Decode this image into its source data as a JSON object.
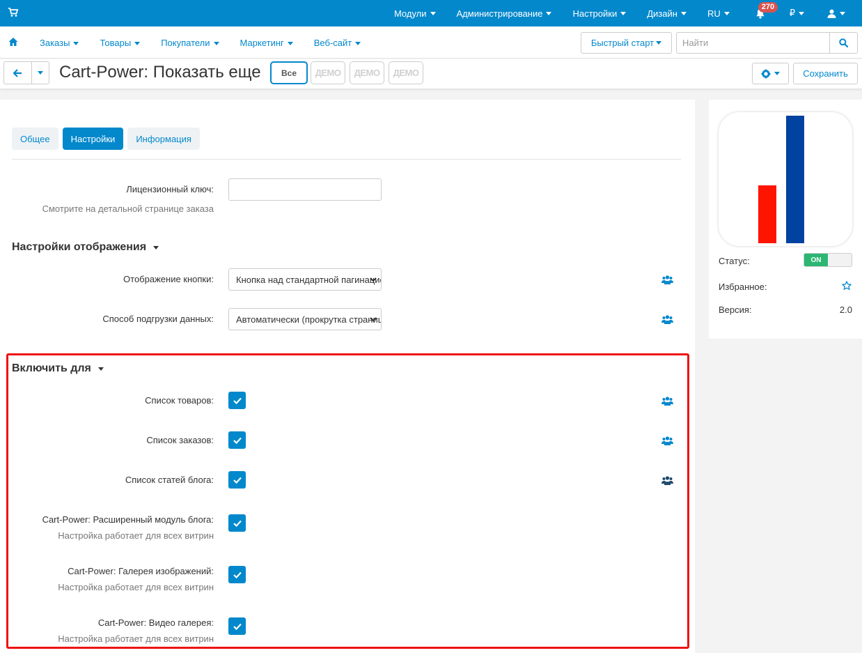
{
  "colors": {
    "primary": "#0388cc",
    "highlight_border": "#ee1111",
    "toggle_on": "#2bb673",
    "logo_bar_red": "#ff1400",
    "logo_bar_blue": "#0042a0"
  },
  "topbar": {
    "icon": "shopping-cart-icon",
    "items": [
      "Модули",
      "Администрирование",
      "Настройки",
      "Дизайн",
      "RU"
    ],
    "notifications_count": "270",
    "currency": "₽"
  },
  "nav": {
    "links": [
      "Заказы",
      "Товары",
      "Покупатели",
      "Маркетинг",
      "Веб-сайт"
    ],
    "quick_start": "Быстрый старт",
    "search_placeholder": "Найти"
  },
  "header": {
    "title": "Cart-Power: Показать еще",
    "storefront_all": "Все",
    "storefront_demo": [
      "ДЕМО",
      "ДЕМО",
      "ДЕМО"
    ],
    "save": "Сохранить"
  },
  "tabs": [
    "Общее",
    "Настройки",
    "Информация"
  ],
  "license": {
    "label": "Лицензионный ключ:",
    "hint": "Смотрите на детальной странице заказа",
    "value": ""
  },
  "display_section": {
    "title": "Настройки отображения",
    "fields": [
      {
        "label": "Отображение кнопки:",
        "value": "Кнопка над стандартной пагинацией"
      },
      {
        "label": "Способ подгрузки данных:",
        "value": "Автоматически (прокрутка страницы)"
      }
    ]
  },
  "enable_section": {
    "title": "Включить для",
    "items": [
      {
        "label": "Список товаров:",
        "checked": true
      },
      {
        "label": "Список заказов:",
        "checked": true
      },
      {
        "label": "Список статей блога:",
        "checked": true
      },
      {
        "label": "Cart-Power: Расширенный модуль блога:",
        "hint": "Настройка работает для всех витрин",
        "checked": true
      },
      {
        "label": "Cart-Power: Галерея изображений:",
        "hint": "Настройка работает для всех витрин",
        "checked": true
      },
      {
        "label": "Cart-Power: Видео галерея:",
        "hint": "Настройка работает для всех витрин",
        "checked": true
      }
    ]
  },
  "sidebar": {
    "status_label": "Статус:",
    "status_value": "ON",
    "favorite_label": "Избранное:",
    "version_label": "Версия:",
    "version_value": "2.0"
  }
}
